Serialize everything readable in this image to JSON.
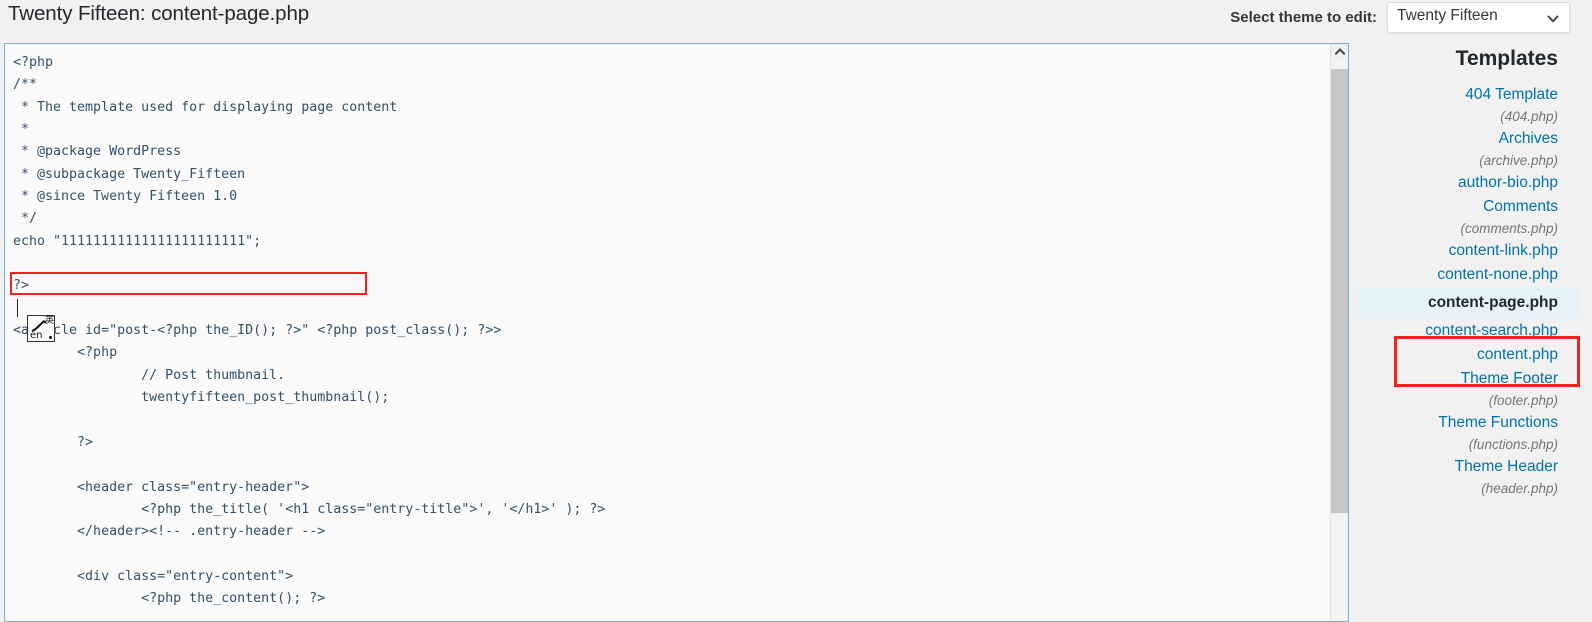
{
  "header": {
    "page_title": "Twenty Fifteen: content-page.php",
    "theme_select_label": "Select theme to edit:",
    "theme_select_value": "Twenty Fifteen",
    "theme_select_options": [
      "Twenty Fifteen"
    ],
    "caret_icon": "chevron-down-icon"
  },
  "editor": {
    "code": "<?php\n/**\n * The template used for displaying page content\n *\n * @package WordPress\n * @subpackage Twenty_Fifteen\n * @since Twenty Fifteen 1.0\n */\necho \"11111111111111111111111\";\n\n?>\n\n<article id=\"post-<?php the_ID(); ?>\" <?php post_class(); ?>>\n\t<?php\n\t\t// Post thumbnail.\n\t\ttwentyfifteen_post_thumbnail();\n\n\t?>\n\n\t<header class=\"entry-header\">\n\t\t<?php the_title( '<h1 class=\"entry-title\">', '</h1>' ); ?>\n\t</header><!-- .entry-header -->\n\n\t<div class=\"entry-content\">\n\t\t<?php the_content(); ?>",
    "highlighted_line": "echo \"11111111111111111111111\";",
    "ime": {
      "language": "en",
      "cjk_mark": "英"
    },
    "scrollbar": {
      "up_arrow_icon": "chevron-up-icon"
    }
  },
  "sidebar": {
    "title": "Templates",
    "items": [
      {
        "name": "404 Template",
        "file": "(404.php)",
        "selected": false
      },
      {
        "name": "Archives",
        "file": "(archive.php)",
        "selected": false
      },
      {
        "name": "author-bio.php",
        "file": "",
        "selected": false
      },
      {
        "name": "Comments",
        "file": "(comments.php)",
        "selected": false
      },
      {
        "name": "content-link.php",
        "file": "",
        "selected": false
      },
      {
        "name": "content-none.php",
        "file": "",
        "selected": false
      },
      {
        "name": "content-page.php",
        "file": "",
        "selected": true
      },
      {
        "name": "content-search.php",
        "file": "",
        "selected": false
      },
      {
        "name": "content.php",
        "file": "",
        "selected": false
      },
      {
        "name": "Theme Footer",
        "file": "(footer.php)",
        "selected": false
      },
      {
        "name": "Theme Functions",
        "file": "(functions.php)",
        "selected": false
      },
      {
        "name": "Theme Header",
        "file": "(header.php)",
        "selected": false
      }
    ]
  },
  "colors": {
    "link": "#0073aa",
    "highlight_box": "#f42020",
    "selected_row_bg": "#e5f2fa",
    "editor_border": "#7badd9",
    "page_bg": "#f1f1f1"
  }
}
